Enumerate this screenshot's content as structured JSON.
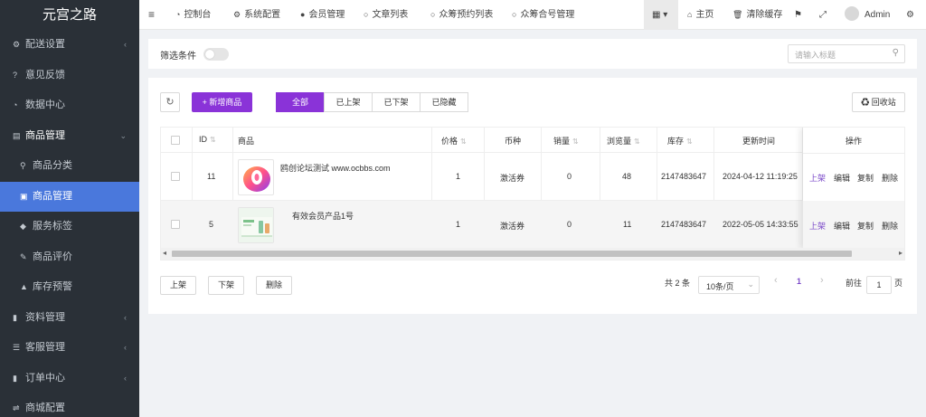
{
  "sidebar": {
    "logo": "元宫之路",
    "items": [
      {
        "label": "配送设置",
        "icon": "cogs-icon",
        "glyph": "⚙",
        "arrow": "‹"
      },
      {
        "label": "意见反馈",
        "icon": "question-circle-icon",
        "glyph": "?",
        "arrow": ""
      },
      {
        "label": "数据中心",
        "icon": "dashboard-icon",
        "glyph": "◔",
        "arrow": ""
      },
      {
        "label": "商品管理",
        "icon": "book-icon",
        "glyph": "▤",
        "arrow": "⌄"
      },
      {
        "label": "商品分类",
        "icon": "sitemap-icon",
        "glyph": "⚲",
        "arrow": ""
      },
      {
        "label": "商品管理",
        "icon": "briefcase-icon",
        "glyph": "▣",
        "arrow": ""
      },
      {
        "label": "服务标签",
        "icon": "tag-icon",
        "glyph": "◆",
        "arrow": ""
      },
      {
        "label": "商品评价",
        "icon": "edit-icon",
        "glyph": "✎",
        "arrow": ""
      },
      {
        "label": "库存预警",
        "icon": "warning-icon",
        "glyph": "▲",
        "arrow": ""
      },
      {
        "label": "资料管理",
        "icon": "file-icon",
        "glyph": "▮",
        "arrow": "‹"
      },
      {
        "label": "客服管理",
        "icon": "list-icon",
        "glyph": "☰",
        "arrow": "‹"
      },
      {
        "label": "订单中心",
        "icon": "file-text-icon",
        "glyph": "▮",
        "arrow": "‹"
      },
      {
        "label": "商城配置",
        "icon": "sliders-icon",
        "glyph": "⇌",
        "arrow": ""
      }
    ]
  },
  "topbar": {
    "menu_glyph": "≡",
    "nav": [
      {
        "label": "控制台",
        "icon": "dashboard-icon",
        "glyph": "◔"
      },
      {
        "label": "系统配置",
        "icon": "gear-icon",
        "glyph": "⚙"
      },
      {
        "label": "会员管理",
        "icon": "user-icon",
        "glyph": "●"
      },
      {
        "label": "文章列表",
        "icon": "circle-icon",
        "glyph": "○"
      },
      {
        "label": "众筹预约列表",
        "icon": "circle-icon",
        "glyph": "○"
      },
      {
        "label": "众筹合号管理",
        "icon": "circle-icon",
        "glyph": "○"
      }
    ],
    "grid_glyph": "▦ ▾",
    "home": "主页",
    "clear_cache": "清除缓存",
    "user": "Admin"
  },
  "filter": {
    "label": "筛选条件",
    "search_placeholder": "请输入标题"
  },
  "toolbar": {
    "refresh_glyph": "↻",
    "add_label": "+ 新增商品",
    "tabs": [
      "全部",
      "已上架",
      "已下架",
      "已隐藏"
    ],
    "recycle_label": "♻ 回收站"
  },
  "table": {
    "headers": [
      "ID",
      "商品",
      "价格",
      "币种",
      "销量",
      "浏览量",
      "库存",
      "更新时间",
      "操作"
    ],
    "rows": [
      {
        "id": "11",
        "name": "鸥创论坛测试 www.ocbbs.com",
        "price": "1",
        "currency": "激活券",
        "sales": "0",
        "views": "48",
        "stock": "2147483647",
        "updated": "2024-04-12 11:19:25"
      },
      {
        "id": "5",
        "name": "有效会员产品1号",
        "price": "1",
        "currency": "激活券",
        "sales": "0",
        "views": "11",
        "stock": "2147483647",
        "updated": "2022-05-05 14:33:55"
      }
    ],
    "actions": [
      "上架",
      "编辑",
      "复制",
      "删除"
    ],
    "scroll_left": "◂",
    "scroll_right": "▸"
  },
  "footer": {
    "bulk": [
      "上架",
      "下架",
      "删除"
    ],
    "total": "共 2 条",
    "page_size": "10条/页",
    "prev": "‹",
    "current_page": "1",
    "next": "›",
    "goto_label": "前往",
    "goto_value": "1",
    "page_unit": "页"
  }
}
